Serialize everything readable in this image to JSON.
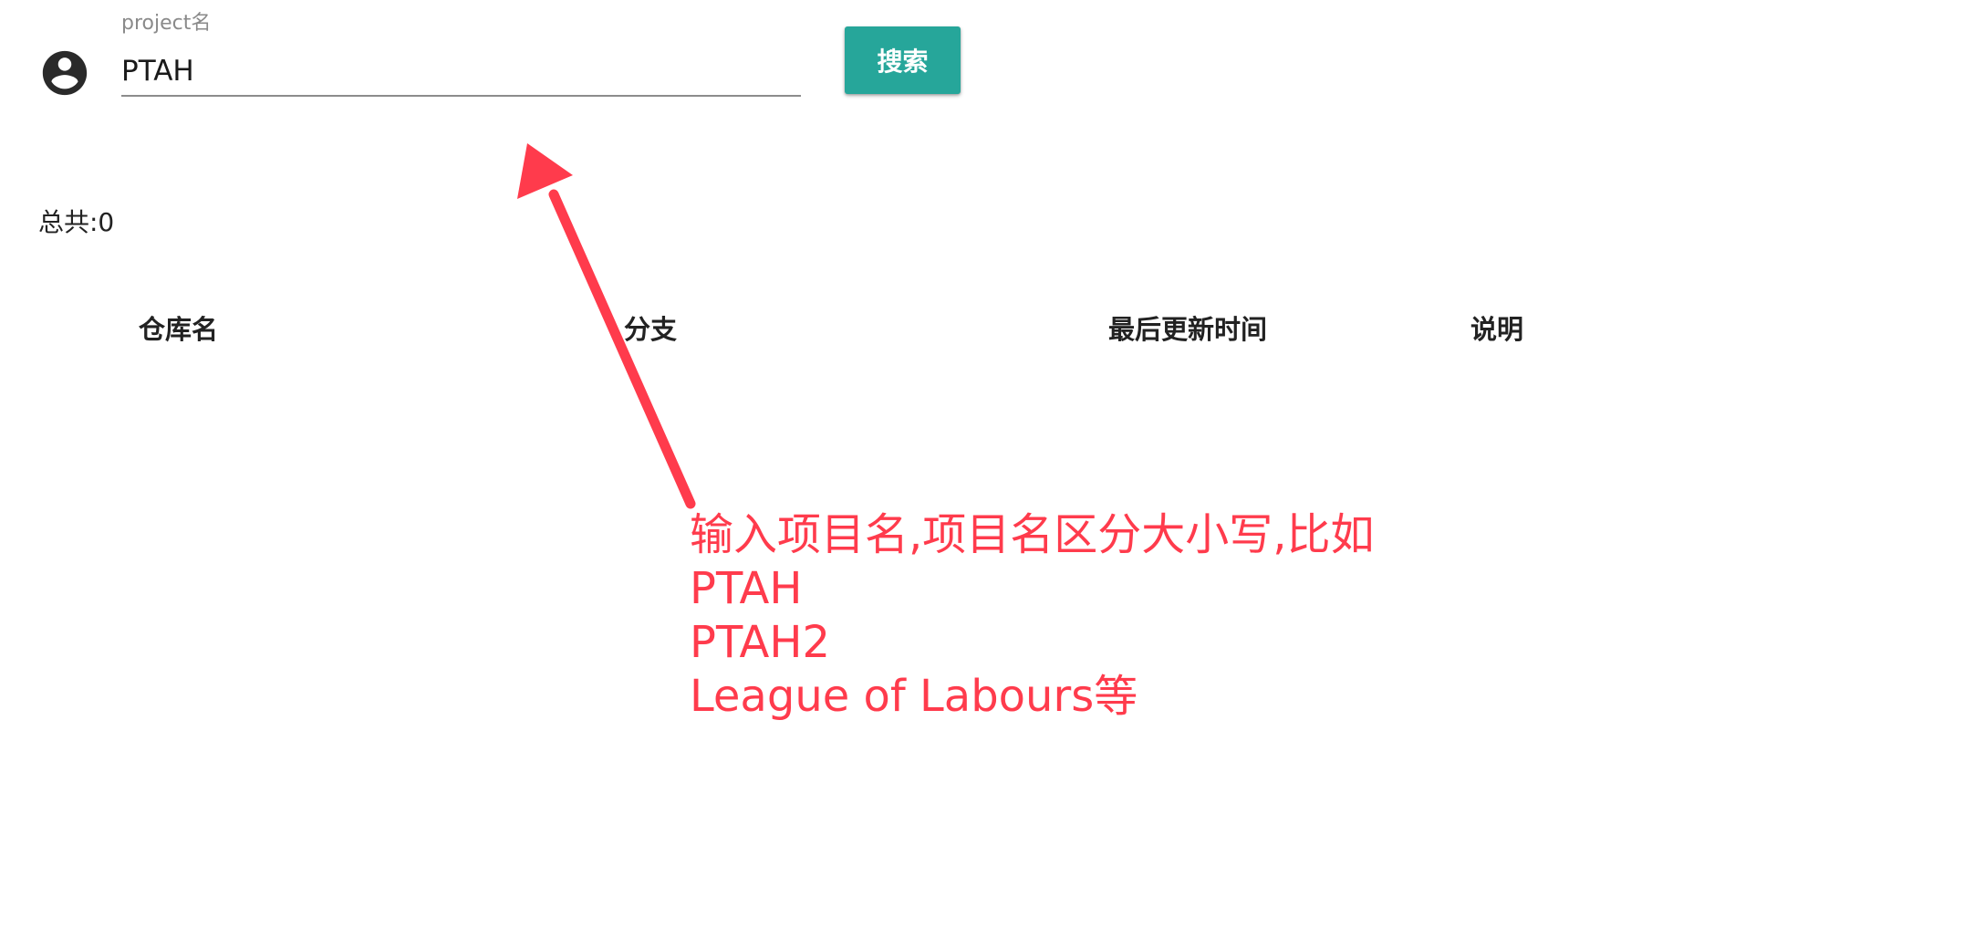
{
  "search": {
    "label": "project名",
    "value": "PTAH",
    "button_label": "搜索"
  },
  "result": {
    "total_label": "总共:0"
  },
  "table": {
    "columns": [
      "仓库名",
      "分支",
      "最后更新时间",
      "说明"
    ],
    "rows": []
  },
  "annotation": {
    "lines": [
      "输入项目名,项目名区分大小写,比如",
      "PTAH",
      "PTAH2",
      "League of Labours等"
    ],
    "color": "#ff3b4c"
  },
  "colors": {
    "accent": "#26a69a",
    "annotation": "#ff3b4c"
  },
  "icons": {
    "avatar": "account-circle-icon",
    "arrow": "arrow-icon"
  }
}
